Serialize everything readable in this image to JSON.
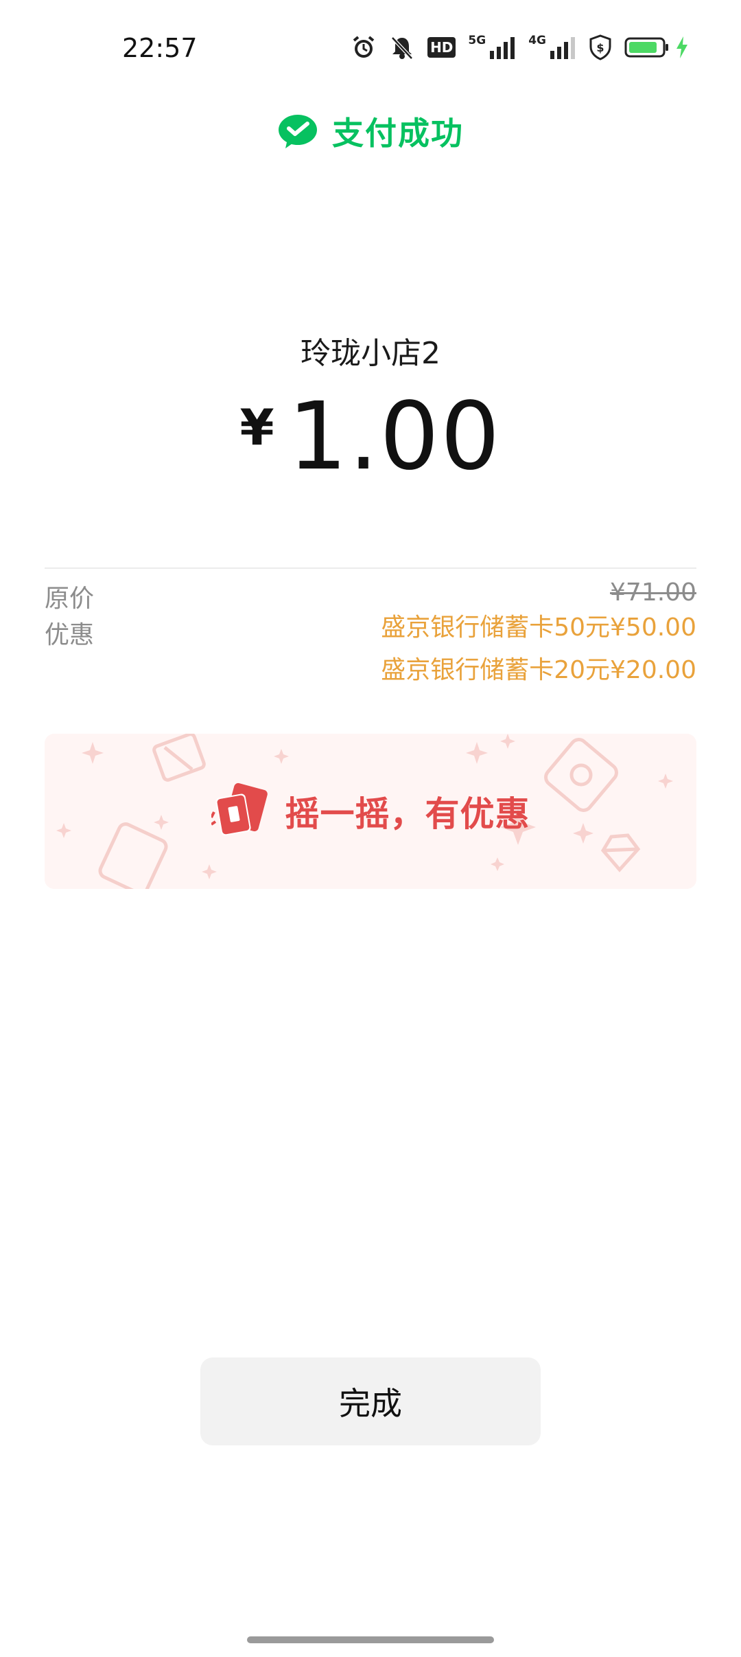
{
  "status_bar": {
    "time": "22:57",
    "icons": [
      "alarm-icon",
      "mute-icon",
      "hd-voice-icon",
      "5g-signal-icon",
      "4g-signal-icon",
      "security-icon",
      "battery-icon",
      "charging-icon"
    ],
    "hd_label": "HD",
    "net_5g": "5G",
    "net_4g": "4G"
  },
  "header": {
    "icon": "wechat-pay-icon",
    "title": "支付成功",
    "accent_color": "#07c160"
  },
  "payment": {
    "merchant": "玲珑小店2",
    "currency": "¥",
    "amount": "1.00"
  },
  "details": {
    "original_label": "原价",
    "original_value": "¥71.00",
    "discount_label": "优惠",
    "discounts": [
      "盛京银行储蓄卡50元¥50.00",
      "盛京银行储蓄卡20元¥20.00"
    ],
    "discount_color": "#e9a23b"
  },
  "promo": {
    "icon": "shake-coupon-icon",
    "text": "摇一摇，有优惠",
    "color": "#e24b4b"
  },
  "actions": {
    "done_label": "完成"
  }
}
